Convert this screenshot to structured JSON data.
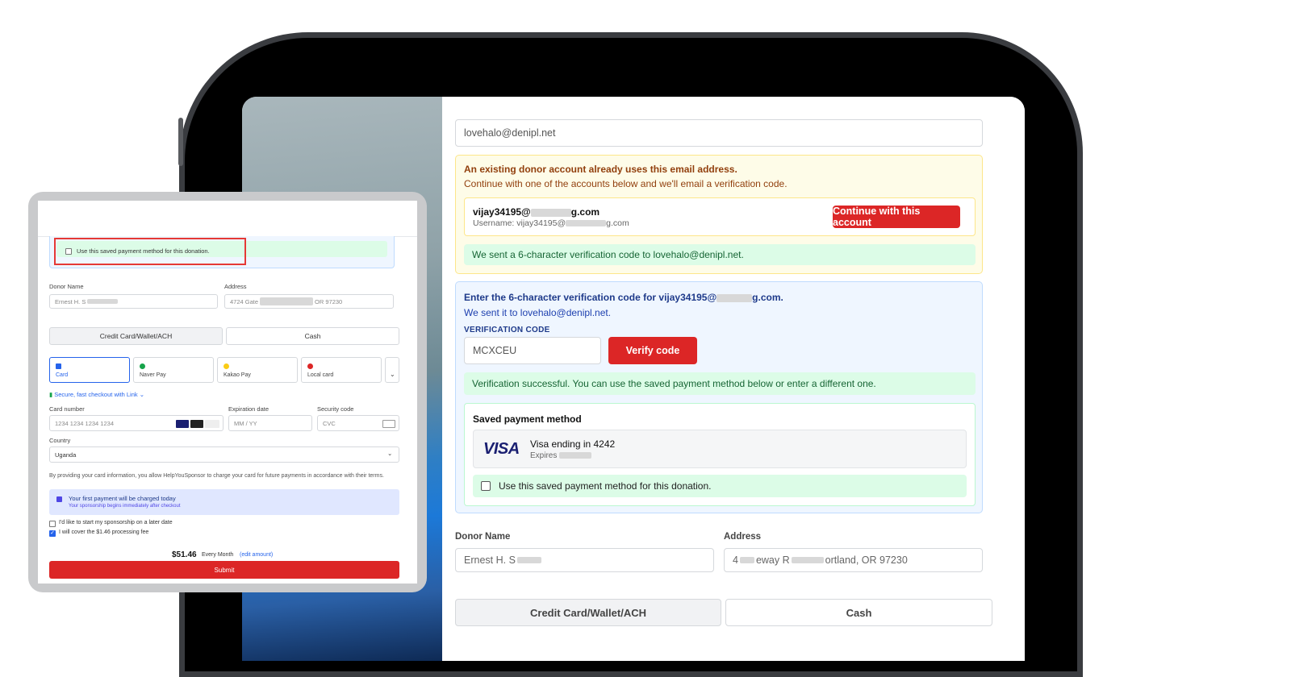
{
  "main": {
    "email_value": "lovehalo@denipl.net",
    "alert": {
      "title": "An existing donor account already uses this email address.",
      "subtitle": "Continue with one of the accounts below and we'll email a verification code.",
      "account_email": "vijay34195@",
      "account_email_suffix": "g.com",
      "account_username": "Username: vijay34195@",
      "account_username_suffix": "g.com",
      "continue_button": "Continue with this account",
      "sent_notice": "We sent a 6-character verification code to lovehalo@denipl.net."
    },
    "verify": {
      "title": "Enter the 6-character verification code for vijay34195@",
      "title_suffix": "g.com.",
      "sent_to": "We sent it to lovehalo@denipl.net.",
      "code_label": "VERIFICATION CODE",
      "code_value": "MCXCEU",
      "verify_button": "Verify code",
      "success": "Verification successful. You can use the saved payment method below or enter a different one.",
      "saved_title": "Saved payment method",
      "card_brand": "VISA",
      "card_text": "Visa ending in 4242",
      "card_expires": "Expires",
      "use_saved_label": "Use this saved payment method for this donation."
    },
    "donor_name_label": "Donor Name",
    "donor_name_value": "Ernest H. Stone",
    "address_label": "Address",
    "address_value": "4724 Gateway Road Portland, OR 97230",
    "address_tail": "ortland, OR 97230",
    "address_mid": "eway R",
    "address_start": "4",
    "donor_name_visible": "Ernest H. S",
    "tab_card": "Credit Card/Wallet/ACH",
    "tab_cash": "Cash"
  },
  "phone": {
    "use_saved_label": "Use this saved payment method for this donation.",
    "donor_name_label": "Donor Name",
    "donor_name_value": "Ernest H. S",
    "address_label": "Address",
    "address_value": "4724 Gate",
    "address_tail": "OR 97230",
    "tab_card": "Credit Card/Wallet/ACH",
    "tab_cash": "Cash",
    "methods": [
      "Card",
      "Naver Pay",
      "Kakao Pay",
      "Local card"
    ],
    "link_text": "Secure, fast checkout with Link",
    "card_number_label": "Card number",
    "card_number_placeholder": "1234 1234 1234 1234",
    "expiration_label": "Expiration date",
    "expiration_placeholder": "MM / YY",
    "security_label": "Security code",
    "security_placeholder": "CVC",
    "country_label": "Country",
    "country_value": "Uganda",
    "terms": "By providing your card information, you allow HelpYouSponsor to charge your card for future payments in accordance with their terms.",
    "info_title": "Your first payment will be charged today",
    "info_sub": "Your sponsorship begins immediately after checkout",
    "later_label": "I'd like to start my sponsorship on a later date",
    "fee_label": "I will cover the $1.46 processing fee",
    "amount": "$51.46",
    "period": "Every Month",
    "edit": "(edit amount)",
    "submit": "Submit"
  },
  "colors": {
    "accent_red": "#dc2626",
    "alert_bg": "#fefce8",
    "alert_text": "#92400e",
    "success_bg": "#dcfce7",
    "info_bg": "#eff6ff",
    "info_text": "#1e3a8a",
    "highlight_border": "#e53935"
  }
}
